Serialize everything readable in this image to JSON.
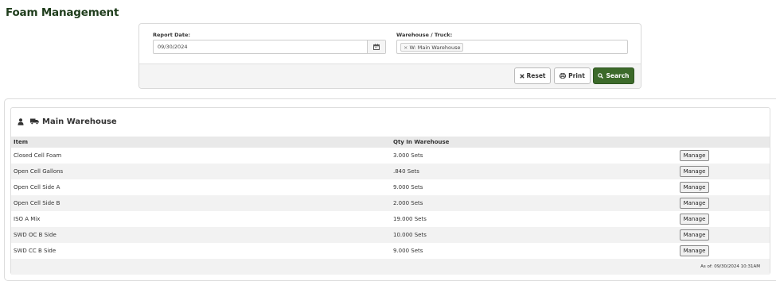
{
  "page": {
    "title": "Foam Management"
  },
  "filters": {
    "report_date_label": "Report Date:",
    "report_date_value": "09/30/2024",
    "warehouse_label": "Warehouse / Truck:",
    "warehouse_tag": "W: Main Warehouse",
    "warehouse_tag_remove": "×"
  },
  "actions": {
    "reset_label": "Reset",
    "print_label": "Print",
    "search_label": "Search"
  },
  "warehouse": {
    "name": "Main Warehouse",
    "columns": {
      "item": "Item",
      "qty": "Qty In Warehouse"
    },
    "manage_label": "Manage",
    "rows": [
      {
        "item": "Closed Cell Foam",
        "qty": "3.000 Sets"
      },
      {
        "item": "Open Cell Gallons",
        "qty": ".840 Sets"
      },
      {
        "item": "Open Cell Side A",
        "qty": "9.000 Sets"
      },
      {
        "item": "Open Cell Side B",
        "qty": "2.000 Sets"
      },
      {
        "item": "ISO A Mix",
        "qty": "19.000 Sets"
      },
      {
        "item": "SWD OC B Side",
        "qty": "10.000 Sets"
      },
      {
        "item": "SWD CC B Side",
        "qty": "9.000 Sets"
      }
    ],
    "as_of": "As of: 09/30/2024 10:31AM"
  },
  "icons": {
    "calendar": "calendar-icon",
    "reset": "times-icon",
    "print": "print-icon",
    "search": "search-icon",
    "user": "user-icon",
    "truck": "truck-icon"
  },
  "colors": {
    "title": "#1f3d1c",
    "search_button": "#3c6a2a"
  }
}
